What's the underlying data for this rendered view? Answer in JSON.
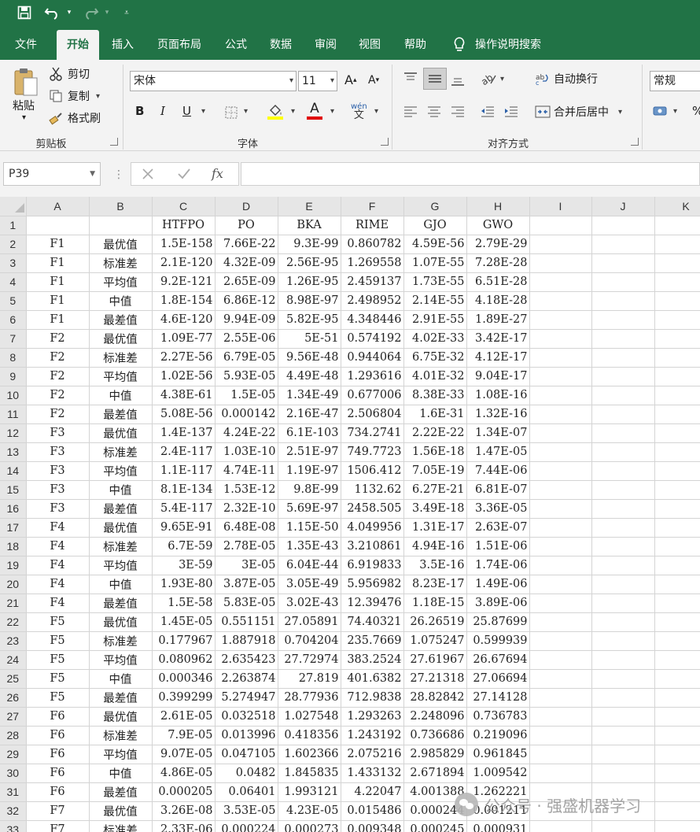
{
  "menu": {
    "tabs": [
      "文件",
      "开始",
      "插入",
      "页面布局",
      "公式",
      "数据",
      "审阅",
      "视图",
      "帮助"
    ],
    "active_index": 1,
    "search": "操作说明搜索"
  },
  "ribbon": {
    "clipboard": {
      "paste": "粘贴",
      "cut": "剪切",
      "copy": "复制",
      "format_painter": "格式刷",
      "label": "剪贴板"
    },
    "font": {
      "name": "宋体",
      "size": "11",
      "label": "字体",
      "bold": "B",
      "italic": "I",
      "underline": "U",
      "font_color_glyph": "A"
    },
    "alignment": {
      "wrap": "自动换行",
      "merge": "合并后居中",
      "label": "对齐方式"
    },
    "number": {
      "format": "常规"
    },
    "colors": {
      "fill": "#ffff00",
      "font": "#e00000",
      "accent": "#217346"
    }
  },
  "formula_bar": {
    "name_box": "P39",
    "fx": "fx",
    "value": ""
  },
  "sheet": {
    "columns": [
      "A",
      "B",
      "C",
      "D",
      "E",
      "F",
      "G",
      "H",
      "I",
      "J",
      "K"
    ],
    "header_row": [
      "",
      "",
      "HTFPO",
      "PO",
      "BKA",
      "RIME",
      "GJO",
      "GWO",
      "",
      "",
      ""
    ],
    "rows": [
      [
        "F1",
        "最优值",
        "1.5E-158",
        "7.66E-22",
        "9.3E-99",
        "0.860782",
        "4.59E-56",
        "2.79E-29"
      ],
      [
        "F1",
        "标准差",
        "2.1E-120",
        "4.32E-09",
        "2.56E-95",
        "1.269558",
        "1.07E-55",
        "7.28E-28"
      ],
      [
        "F1",
        "平均值",
        "9.2E-121",
        "2.65E-09",
        "1.26E-95",
        "2.459137",
        "1.73E-55",
        "6.51E-28"
      ],
      [
        "F1",
        "中值",
        "1.8E-154",
        "6.86E-12",
        "8.98E-97",
        "2.498952",
        "2.14E-55",
        "4.18E-28"
      ],
      [
        "F1",
        "最差值",
        "4.6E-120",
        "9.94E-09",
        "5.82E-95",
        "4.348446",
        "2.91E-55",
        "1.89E-27"
      ],
      [
        "F2",
        "最优值",
        "1.09E-77",
        "2.55E-06",
        "5E-51",
        "0.574192",
        "4.02E-33",
        "3.42E-17"
      ],
      [
        "F2",
        "标准差",
        "2.27E-56",
        "6.79E-05",
        "9.56E-48",
        "0.944064",
        "6.75E-32",
        "4.12E-17"
      ],
      [
        "F2",
        "平均值",
        "1.02E-56",
        "5.93E-05",
        "4.49E-48",
        "1.293616",
        "4.01E-32",
        "9.04E-17"
      ],
      [
        "F2",
        "中值",
        "4.38E-61",
        "1.5E-05",
        "1.34E-49",
        "0.677006",
        "8.38E-33",
        "1.08E-16"
      ],
      [
        "F2",
        "最差值",
        "5.08E-56",
        "0.000142",
        "2.16E-47",
        "2.506804",
        "1.6E-31",
        "1.32E-16"
      ],
      [
        "F3",
        "最优值",
        "1.4E-137",
        "4.24E-22",
        "6.1E-103",
        "734.2741",
        "2.22E-22",
        "1.34E-07"
      ],
      [
        "F3",
        "标准差",
        "2.4E-117",
        "1.03E-10",
        "2.51E-97",
        "749.7723",
        "1.56E-18",
        "1.47E-05"
      ],
      [
        "F3",
        "平均值",
        "1.1E-117",
        "4.74E-11",
        "1.19E-97",
        "1506.412",
        "7.05E-19",
        "7.44E-06"
      ],
      [
        "F3",
        "中值",
        "8.1E-134",
        "1.53E-12",
        "9.8E-99",
        "1132.62",
        "6.27E-21",
        "6.81E-07"
      ],
      [
        "F3",
        "最差值",
        "5.4E-117",
        "2.32E-10",
        "5.69E-97",
        "2458.505",
        "3.49E-18",
        "3.36E-05"
      ],
      [
        "F4",
        "最优值",
        "9.65E-91",
        "6.48E-08",
        "1.15E-50",
        "4.049956",
        "1.31E-17",
        "2.63E-07"
      ],
      [
        "F4",
        "标准差",
        "6.7E-59",
        "2.78E-05",
        "1.35E-43",
        "3.210861",
        "4.94E-16",
        "1.51E-06"
      ],
      [
        "F4",
        "平均值",
        "3E-59",
        "3E-05",
        "6.04E-44",
        "6.919833",
        "3.5E-16",
        "1.74E-06"
      ],
      [
        "F4",
        "中值",
        "1.93E-80",
        "3.87E-05",
        "3.05E-49",
        "5.956982",
        "8.23E-17",
        "1.49E-06"
      ],
      [
        "F4",
        "最差值",
        "1.5E-58",
        "5.83E-05",
        "3.02E-43",
        "12.39476",
        "1.18E-15",
        "3.89E-06"
      ],
      [
        "F5",
        "最优值",
        "1.45E-05",
        "0.551151",
        "27.05891",
        "74.40321",
        "26.26519",
        "25.87699"
      ],
      [
        "F5",
        "标准差",
        "0.177967",
        "1.887918",
        "0.704204",
        "235.7669",
        "1.075247",
        "0.599939"
      ],
      [
        "F5",
        "平均值",
        "0.080962",
        "2.635423",
        "27.72974",
        "383.2524",
        "27.61967",
        "26.67694"
      ],
      [
        "F5",
        "中值",
        "0.000346",
        "2.263874",
        "27.819",
        "401.6382",
        "27.21318",
        "27.06694"
      ],
      [
        "F5",
        "最差值",
        "0.399299",
        "5.274947",
        "28.77936",
        "712.9838",
        "28.82842",
        "27.14128"
      ],
      [
        "F6",
        "最优值",
        "2.61E-05",
        "0.032518",
        "1.027548",
        "1.293263",
        "2.248096",
        "0.736783"
      ],
      [
        "F6",
        "标准差",
        "7.9E-05",
        "0.013996",
        "0.418356",
        "1.243192",
        "0.736686",
        "0.219096"
      ],
      [
        "F6",
        "平均值",
        "9.07E-05",
        "0.047105",
        "1.602366",
        "2.075216",
        "2.985829",
        "0.961845"
      ],
      [
        "F6",
        "中值",
        "4.86E-05",
        "0.0482",
        "1.845835",
        "1.433132",
        "2.671894",
        "1.009542"
      ],
      [
        "F6",
        "最差值",
        "0.000205",
        "0.06401",
        "1.993121",
        "4.22047",
        "4.001388",
        "1.262221"
      ],
      [
        "F7",
        "最优值",
        "3.26E-08",
        "3.53E-05",
        "4.23E-05",
        "0.015486",
        "0.000244",
        "0.001211"
      ],
      [
        "F7",
        "标准差",
        "2.33E-06",
        "0.000224",
        "0.000273",
        "0.009348",
        "0.000245",
        "0.000931"
      ]
    ]
  },
  "watermark": "公众号 · 强盛机器学习"
}
